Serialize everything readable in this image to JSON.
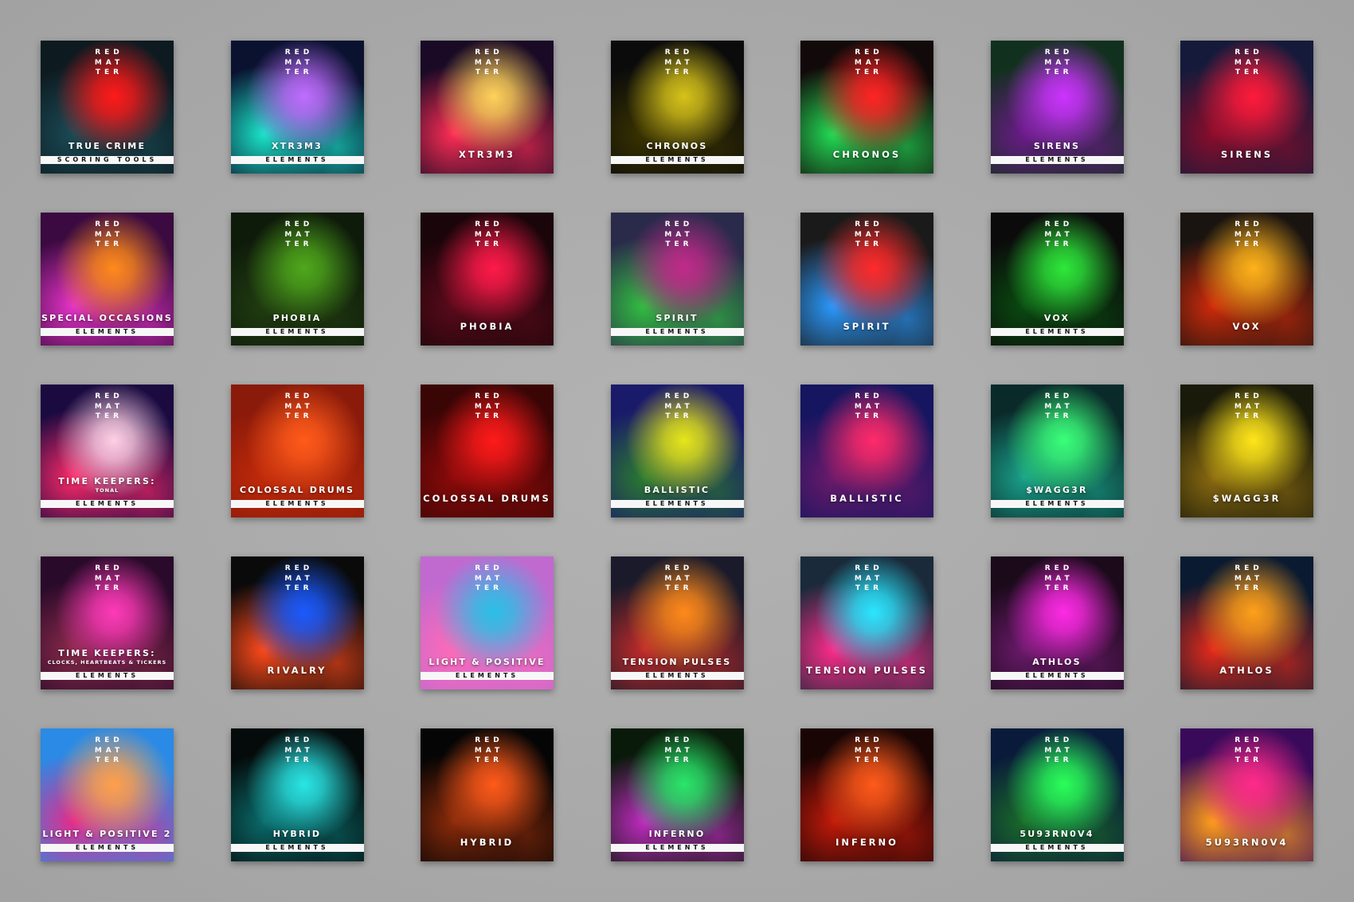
{
  "brand": {
    "logo": [
      "RED",
      "MAT",
      "TER"
    ]
  },
  "covers": [
    {
      "title": "TRUE CRIME",
      "band": "SCORING TOOLS",
      "bg": "#0d1a20",
      "c1": "#ff1a1a",
      "c2": "#1a4a55"
    },
    {
      "title": "XTR3M3",
      "band": "ELEMENTS",
      "bg": "#0a1230",
      "c1": "#c06cff",
      "c2": "#19e6c8"
    },
    {
      "title": "XTR3M3",
      "band": "",
      "bg": "#1a0a25",
      "c1": "#ffd25a",
      "c2": "#ff2d55"
    },
    {
      "title": "CHRONOS",
      "band": "ELEMENTS",
      "bg": "#0b0b0b",
      "c1": "#d6c21a",
      "c2": "#3a3300"
    },
    {
      "title": "CHRONOS",
      "band": "",
      "bg": "#120a0a",
      "c1": "#ff2424",
      "c2": "#22dd55"
    },
    {
      "title": "SIRENS",
      "band": "ELEMENTS",
      "bg": "#12301e",
      "c1": "#cc33ff",
      "c2": "#6a1a88"
    },
    {
      "title": "SIRENS",
      "band": "",
      "bg": "#161a3a",
      "c1": "#ff1a3a",
      "c2": "#8a0c2a"
    },
    {
      "title": "SPECIAL OCCASIONS",
      "band": "ELEMENTS",
      "bg": "#3a0a40",
      "c1": "#ff8a1a",
      "c2": "#e633c8"
    },
    {
      "title": "PHOBIA",
      "band": "ELEMENTS",
      "bg": "#0e1a0a",
      "c1": "#4fa81c",
      "c2": "#203c10"
    },
    {
      "title": "PHOBIA",
      "band": "",
      "bg": "#1a050a",
      "c1": "#ff1a4a",
      "c2": "#5a0a1a"
    },
    {
      "title": "SPIRIT",
      "band": "ELEMENTS",
      "bg": "#2a2a4a",
      "c1": "#c02a8a",
      "c2": "#30c040"
    },
    {
      "title": "SPIRIT",
      "band": "",
      "bg": "#1a1a1a",
      "c1": "#ff2a2a",
      "c2": "#2a9aff"
    },
    {
      "title": "VOX",
      "band": "ELEMENTS",
      "bg": "#0b0b0b",
      "c1": "#2ee83a",
      "c2": "#0a4a10"
    },
    {
      "title": "VOX",
      "band": "",
      "bg": "#1a1410",
      "c1": "#ffb21a",
      "c2": "#d02a0a"
    },
    {
      "title": "TIME KEEPERS:",
      "sub": "TONAL",
      "band": "ELEMENTS",
      "bg": "#1a0a40",
      "c1": "#ffd0e6",
      "c2": "#ff2a6a"
    },
    {
      "title": "COLOSSAL DRUMS",
      "band": "ELEMENTS",
      "bg": "#8a1a0a",
      "c1": "#ff5a1a",
      "c2": "#c02a0a"
    },
    {
      "title": "COLOSSAL DRUMS",
      "band": "",
      "bg": "#3a0505",
      "c1": "#ff1a1a",
      "c2": "#8a0a0a"
    },
    {
      "title": "BALLISTIC",
      "band": "ELEMENTS",
      "bg": "#1a1a6a",
      "c1": "#e6e61a",
      "c2": "#2a7a30"
    },
    {
      "title": "BALLISTIC",
      "band": "",
      "bg": "#151560",
      "c1": "#ff2a6a",
      "c2": "#6a1a6a"
    },
    {
      "title": "$WAGG3R",
      "band": "ELEMENTS",
      "bg": "#0a2a2a",
      "c1": "#3aff7a",
      "c2": "#1aa08a"
    },
    {
      "title": "$WAGG3R",
      "band": "",
      "bg": "#1a1a0a",
      "c1": "#ffe61a",
      "c2": "#8a6a10"
    },
    {
      "title": "TIME KEEPERS:",
      "sub": "CLOCKS, HEARTBEATS & TICKERS",
      "band": "ELEMENTS",
      "bg": "#2a0a2a",
      "c1": "#ff3ab8",
      "c2": "#8a2a4a"
    },
    {
      "title": "RIVALRY",
      "band": "",
      "bg": "#0a0a0a",
      "c1": "#1a5aff",
      "c2": "#ff4a1a"
    },
    {
      "title": "LIGHT & POSITIVE",
      "band": "ELEMENTS",
      "bg": "#c06ad0",
      "c1": "#2ac0e6",
      "c2": "#ff6ab8"
    },
    {
      "title": "TENSION PULSES",
      "band": "ELEMENTS",
      "bg": "#1a1a2a",
      "c1": "#ff8a1a",
      "c2": "#c02a2a"
    },
    {
      "title": "TENSION PULSES",
      "band": "",
      "bg": "#1a2a3a",
      "c1": "#2ae6ff",
      "c2": "#ff2a8a"
    },
    {
      "title": "ATHLOS",
      "band": "ELEMENTS",
      "bg": "#1a0a1a",
      "c1": "#ff2ae6",
      "c2": "#6a1a6a"
    },
    {
      "title": "ATHLOS",
      "band": "",
      "bg": "#0a1a30",
      "c1": "#ffa01a",
      "c2": "#e62a1a"
    },
    {
      "title": "LIGHT & POSITIVE 2",
      "band": "ELEMENTS",
      "bg": "#2a8ae6",
      "c1": "#ffa04a",
      "c2": "#e62a8a"
    },
    {
      "title": "HYBRID",
      "band": "ELEMENTS",
      "bg": "#050a0a",
      "c1": "#2ae6e6",
      "c2": "#0a6a6a"
    },
    {
      "title": "HYBRID",
      "band": "",
      "bg": "#050505",
      "c1": "#ff5a1a",
      "c2": "#8a2a0a"
    },
    {
      "title": "INFERNO",
      "band": "ELEMENTS",
      "bg": "#0a1a0a",
      "c1": "#2ae66a",
      "c2": "#c02ac0"
    },
    {
      "title": "INFERNO",
      "band": "",
      "bg": "#1a0505",
      "c1": "#ff5a1a",
      "c2": "#c01a0a"
    },
    {
      "title": "5U93RN0V4",
      "band": "ELEMENTS",
      "bg": "#0a1a3a",
      "c1": "#2aff5a",
      "c2": "#1a6a2a"
    },
    {
      "title": "5U93RN0V4",
      "band": "",
      "bg": "#3a0a5a",
      "c1": "#ff2a8a",
      "c2": "#ffa01a"
    }
  ]
}
